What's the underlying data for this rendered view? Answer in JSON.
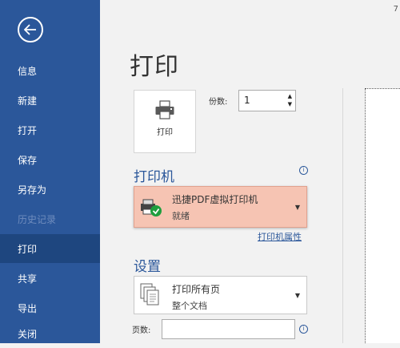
{
  "sidebar": {
    "items": [
      {
        "label": "信息",
        "state": "normal"
      },
      {
        "label": "新建",
        "state": "normal"
      },
      {
        "label": "打开",
        "state": "normal"
      },
      {
        "label": "保存",
        "state": "normal"
      },
      {
        "label": "另存为",
        "state": "normal"
      },
      {
        "label": "历史记录",
        "state": "disabled"
      },
      {
        "label": "打印",
        "state": "active"
      },
      {
        "label": "共享",
        "state": "normal"
      },
      {
        "label": "导出",
        "state": "normal"
      },
      {
        "label": "关闭",
        "state": "normal"
      }
    ]
  },
  "main": {
    "title": "打印",
    "print_button_label": "打印",
    "copies_label": "份数:",
    "copies_value": "1",
    "printer_section_title": "打印机",
    "printer_name": "迅捷PDF虚拟打印机",
    "printer_status": "就绪",
    "printer_properties_link": "打印机属性",
    "settings_section_title": "设置",
    "print_range_main": "打印所有页",
    "print_range_sub": "整个文档",
    "pages_label": "页数:",
    "pages_value": ""
  },
  "corner_text": "7",
  "colors": {
    "sidebar_bg": "#2b579a",
    "sidebar_active": "#1e467f",
    "printer_highlight": "#f6c4b3",
    "accent": "#2b579a"
  }
}
